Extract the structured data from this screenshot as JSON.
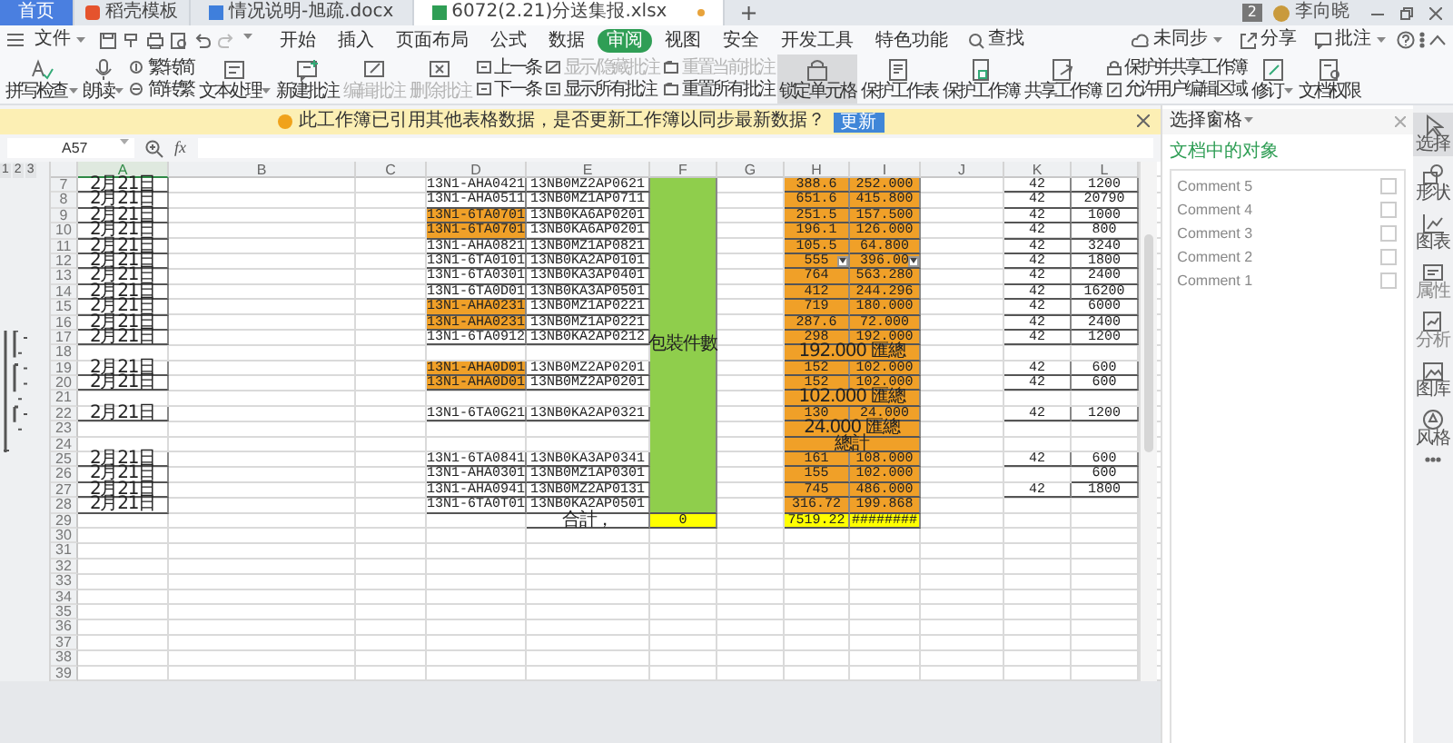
{
  "title_bar": {
    "tabs": [
      {
        "label": "首页",
        "kind": "home",
        "selected": false,
        "modified": false
      },
      {
        "label": "稻壳模板",
        "kind": "app",
        "selected": false,
        "modified": false
      },
      {
        "label": "情况说明-旭疏.docx",
        "kind": "doc",
        "selected": false,
        "modified": false
      },
      {
        "label": "6072(2.21)分送集报.xlsx",
        "kind": "sheet",
        "selected": true,
        "modified": true
      }
    ],
    "new_tab": "+",
    "badge": "2",
    "user": "李向晓"
  },
  "menu": {
    "file": "文件",
    "tabs": [
      {
        "label": "开始",
        "selected": false
      },
      {
        "label": "插入",
        "selected": false
      },
      {
        "label": "页面布局",
        "selected": false
      },
      {
        "label": "公式",
        "selected": false
      },
      {
        "label": "数据",
        "selected": false
      },
      {
        "label": "审阅",
        "selected": true
      },
      {
        "label": "视图",
        "selected": false
      },
      {
        "label": "安全",
        "selected": false
      },
      {
        "label": "开发工具",
        "selected": false
      },
      {
        "label": "特色功能",
        "selected": false
      }
    ],
    "search": "查找",
    "sync": "未同步",
    "share": "分享",
    "comment": "批注"
  },
  "ribbon": [
    {
      "kind": "large",
      "label": "拼写检查",
      "caret": true,
      "disabled": false,
      "pressed": false
    },
    {
      "kind": "large",
      "label": "朗读",
      "caret": true,
      "disabled": false,
      "pressed": false
    },
    {
      "kind": "stack",
      "items": [
        {
          "label": "繁转简",
          "disabled": false
        },
        {
          "label": "简转繁",
          "disabled": false
        }
      ]
    },
    {
      "kind": "large",
      "label": "文本处理",
      "caret": true,
      "disabled": false,
      "pressed": false
    },
    {
      "kind": "large",
      "label": "新建批注",
      "caret": false,
      "disabled": false,
      "pressed": false
    },
    {
      "kind": "large",
      "label": "编辑批注",
      "caret": false,
      "disabled": true,
      "pressed": false
    },
    {
      "kind": "large",
      "label": "删除批注",
      "caret": false,
      "disabled": true,
      "pressed": false
    },
    {
      "kind": "stack",
      "items": [
        {
          "label": "上一条",
          "disabled": false
        },
        {
          "label": "下一条",
          "disabled": false
        }
      ]
    },
    {
      "kind": "stack",
      "items": [
        {
          "label": "显示/隐藏批注",
          "disabled": true
        },
        {
          "label": "显示所有批注",
          "disabled": false
        }
      ]
    },
    {
      "kind": "stack",
      "items": [
        {
          "label": "重置当前批注",
          "disabled": true
        },
        {
          "label": "重置所有批注",
          "disabled": false
        }
      ]
    },
    {
      "kind": "large",
      "label": "锁定单元格",
      "caret": false,
      "disabled": false,
      "pressed": true
    },
    {
      "kind": "large",
      "label": "保护工作表",
      "caret": false,
      "disabled": false,
      "pressed": false
    },
    {
      "kind": "large",
      "label": "保护工作簿",
      "caret": false,
      "disabled": false,
      "pressed": false
    },
    {
      "kind": "large",
      "label": "共享工作簿",
      "caret": false,
      "disabled": false,
      "pressed": false
    },
    {
      "kind": "stack",
      "items": [
        {
          "label": "保护并共享工作簿",
          "disabled": false
        },
        {
          "label": "允许用户编辑区域",
          "disabled": false
        }
      ]
    },
    {
      "kind": "large",
      "label": "修订",
      "caret": true,
      "disabled": false,
      "pressed": false
    },
    {
      "kind": "large",
      "label": "文档权限",
      "caret": false,
      "disabled": false,
      "pressed": false
    }
  ],
  "notification": {
    "message": "此工作簿已引用其他表格数据，是否更新工作簿以同步最新数据？",
    "button": "更新"
  },
  "formula_bar": {
    "name_box": "A57",
    "fx": "fx"
  },
  "sheet": {
    "outline_levels": [
      "1",
      "2",
      "3"
    ],
    "columns": [
      {
        "label": "A",
        "selected": true
      },
      {
        "label": "B",
        "selected": false
      },
      {
        "label": "C",
        "selected": false
      },
      {
        "label": "D",
        "selected": false
      },
      {
        "label": "E",
        "selected": false
      },
      {
        "label": "F",
        "selected": false
      },
      {
        "label": "G",
        "selected": false
      },
      {
        "label": "H",
        "selected": false
      },
      {
        "label": "I",
        "selected": false
      },
      {
        "label": "J",
        "selected": false
      },
      {
        "label": "K",
        "selected": false
      },
      {
        "label": "L",
        "selected": false
      }
    ],
    "merged_label": "包裝件數",
    "rows": [
      {
        "n": "7",
        "kind": "data",
        "a": "2月21日",
        "d": "13N1-AHA0421",
        "d_highlight": false,
        "e": "13NB0MZ2AP0621",
        "h": "388.6",
        "i": "252.000",
        "k": "42",
        "l": "1200"
      },
      {
        "n": "8",
        "kind": "data",
        "a": "2月21日",
        "d": "13N1-AHA0511",
        "d_highlight": false,
        "e": "13NB0MZ1AP0711",
        "h": "651.6",
        "i": "415.800",
        "k": "42",
        "l": "20790"
      },
      {
        "n": "9",
        "kind": "data",
        "a": "2月21日",
        "d": "13N1-6TA0701",
        "d_highlight": true,
        "e": "13NB0KA6AP0201",
        "h": "251.5",
        "i": "157.500",
        "k": "42",
        "l": "1000"
      },
      {
        "n": "10",
        "kind": "data",
        "a": "2月21日",
        "d": "13N1-6TA0701",
        "d_highlight": true,
        "e": "13NB0KA6AP0201",
        "h": "196.1",
        "i": "126.000",
        "k": "42",
        "l": "800"
      },
      {
        "n": "11",
        "kind": "data",
        "a": "2月21日",
        "d": "13N1-AHA0821",
        "d_highlight": false,
        "e": "13NB0MZ1AP0821",
        "h": "105.5",
        "i": "64.800",
        "k": "42",
        "l": "3240"
      },
      {
        "n": "12",
        "kind": "data",
        "a": "2月21日",
        "d": "13N1-6TA0101",
        "d_highlight": false,
        "e": "13NB0KA2AP0101",
        "h": "555",
        "i": "396.00",
        "k": "42",
        "l": "1800",
        "h_dropdown": true,
        "i_dropdown": true
      },
      {
        "n": "13",
        "kind": "data",
        "a": "2月21日",
        "d": "13N1-6TA0301",
        "d_highlight": false,
        "e": "13NB0KA3AP0401",
        "h": "764",
        "i": "563.280",
        "k": "42",
        "l": "2400"
      },
      {
        "n": "14",
        "kind": "data",
        "a": "2月21日",
        "d": "13N1-6TA0D01",
        "d_highlight": false,
        "e": "13NB0KA3AP0501",
        "h": "412",
        "i": "244.296",
        "k": "42",
        "l": "16200"
      },
      {
        "n": "15",
        "kind": "data",
        "a": "2月21日",
        "d": "13N1-AHA0231",
        "d_highlight": true,
        "e": "13NB0MZ1AP0221",
        "h": "719",
        "i": "180.000",
        "k": "42",
        "l": "6000"
      },
      {
        "n": "16",
        "kind": "data",
        "a": "2月21日",
        "d": "13N1-AHA0231",
        "d_highlight": true,
        "e": "13NB0MZ1AP0221",
        "h": "287.6",
        "i": "72.000",
        "k": "42",
        "l": "2400"
      },
      {
        "n": "17",
        "kind": "data",
        "a": "2月21日",
        "d": "13N1-6TA0912",
        "d_highlight": false,
        "e": "13NB0KA2AP0212",
        "h": "298",
        "i": "192.000",
        "k": "42",
        "l": "1200"
      },
      {
        "n": "18",
        "kind": "subtotal",
        "text": "192.000 匯總"
      },
      {
        "n": "19",
        "kind": "data",
        "a": "2月21日",
        "d": "13N1-AHA0D01",
        "d_highlight": true,
        "e": "13NB0MZ2AP0201",
        "h": "152",
        "i": "102.000",
        "k": "42",
        "l": "600"
      },
      {
        "n": "20",
        "kind": "data",
        "a": "2月21日",
        "d": "13N1-AHA0D01",
        "d_highlight": true,
        "e": "13NB0MZ2AP0201",
        "h": "152",
        "i": "102.000",
        "k": "42",
        "l": "600"
      },
      {
        "n": "21",
        "kind": "subtotal",
        "text": "102.000 匯總"
      },
      {
        "n": "22",
        "kind": "data",
        "a": "2月21日",
        "d": "13N1-6TA0G21",
        "d_highlight": false,
        "e": "13NB0KA2AP0321",
        "h": "130",
        "i": "24.000",
        "k": "42",
        "l": "1200"
      },
      {
        "n": "23",
        "kind": "subtotal",
        "text": "24.000 匯總"
      },
      {
        "n": "24",
        "kind": "total",
        "text": "總計"
      },
      {
        "n": "25",
        "kind": "data",
        "a": "2月21日",
        "d": "13N1-6TA0841",
        "d_highlight": false,
        "e": "13NB0KA3AP0341",
        "h": "161",
        "i": "108.000",
        "k": "42",
        "l": "600"
      },
      {
        "n": "26",
        "kind": "data",
        "a": "2月21日",
        "d": "13N1-AHA0301",
        "d_highlight": false,
        "e": "13NB0MZ1AP0301",
        "h": "155",
        "i": "102.000",
        "l": "600"
      },
      {
        "n": "27",
        "kind": "data",
        "a": "2月21日",
        "d": "13N1-AHA0941",
        "d_highlight": false,
        "e": "13NB0MZ2AP0131",
        "h": "745",
        "i": "486.000",
        "k": "42",
        "l": "1800"
      },
      {
        "n": "28",
        "kind": "data",
        "a": "2月21日",
        "d": "13N1-6TA0T01",
        "d_highlight": false,
        "e": "13NB0KA2AP0501",
        "h": "316.72",
        "i": "199.868"
      },
      {
        "n": "29",
        "kind": "sum",
        "e": "合計，",
        "f": "0",
        "h": "7519.22",
        "i": "########"
      },
      {
        "n": "30",
        "kind": "empty"
      },
      {
        "n": "31",
        "kind": "empty"
      },
      {
        "n": "32",
        "kind": "empty"
      },
      {
        "n": "33",
        "kind": "empty"
      },
      {
        "n": "34",
        "kind": "empty"
      },
      {
        "n": "35",
        "kind": "empty"
      },
      {
        "n": "36",
        "kind": "empty"
      },
      {
        "n": "37",
        "kind": "empty"
      },
      {
        "n": "38",
        "kind": "empty"
      },
      {
        "n": "39",
        "kind": "empty"
      }
    ]
  },
  "panel": {
    "title": "选择窗格",
    "subtitle": "文档中的对象",
    "objects": [
      {
        "label": "Comment 5",
        "checked": false
      },
      {
        "label": "Comment 4",
        "checked": false
      },
      {
        "label": "Comment 3",
        "checked": false
      },
      {
        "label": "Comment 2",
        "checked": false
      },
      {
        "label": "Comment 1",
        "checked": false
      }
    ]
  },
  "rail": [
    {
      "label": "选择",
      "selected": true,
      "disabled": false
    },
    {
      "label": "形状",
      "selected": false,
      "disabled": false
    },
    {
      "label": "图表",
      "selected": false,
      "disabled": false
    },
    {
      "label": "属性",
      "selected": false,
      "disabled": true
    },
    {
      "label": "分析",
      "selected": false,
      "disabled": true
    },
    {
      "label": "图库",
      "selected": false,
      "disabled": false
    },
    {
      "label": "风格",
      "selected": false,
      "disabled": false
    }
  ]
}
